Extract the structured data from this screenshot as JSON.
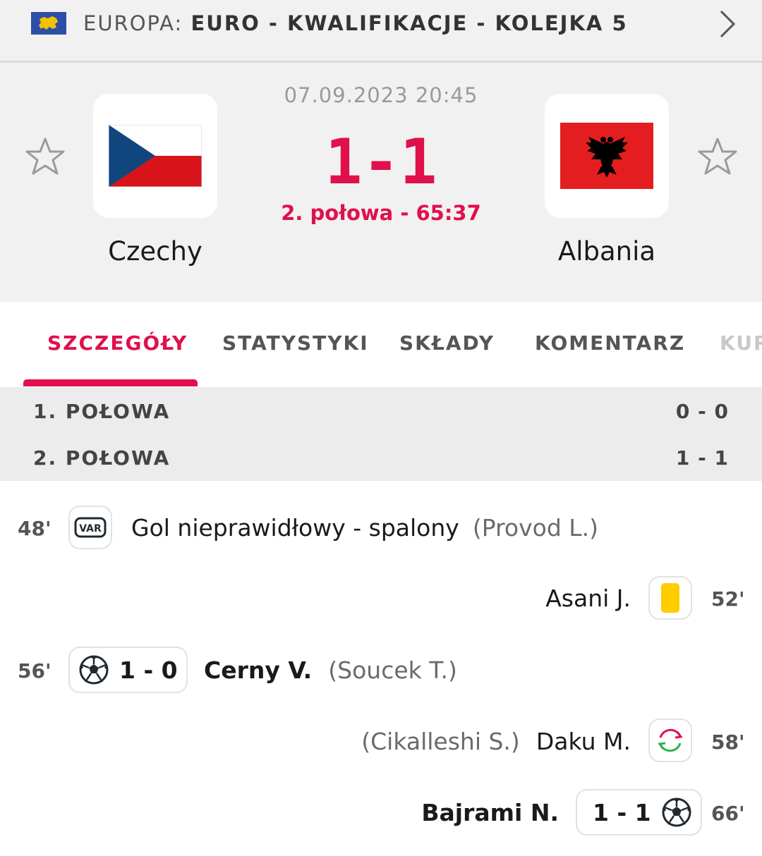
{
  "league": {
    "region": "EUROPA:",
    "competition": "EURO - KWALIFIKACJE - KOLEJKA 5",
    "flag_icon": "europe-flag-icon"
  },
  "match": {
    "datetime": "07.09.2023 20:45",
    "score": "1-1",
    "status": "2. połowa - 65:37",
    "home": {
      "name": "Czechy",
      "flag_icon": "czech-flag-icon"
    },
    "away": {
      "name": "Albania",
      "flag_icon": "albania-flag-icon"
    }
  },
  "tabs": [
    {
      "label": "SZCZEGÓŁY",
      "active": true
    },
    {
      "label": "STATYSTYKI",
      "active": false
    },
    {
      "label": "SKŁADY",
      "active": false
    },
    {
      "label": "KOMENTARZ",
      "active": false
    },
    {
      "label": "KURSY",
      "active": false
    }
  ],
  "periods": [
    {
      "label": "1. POŁOWA",
      "score": "0 - 0"
    },
    {
      "label": "2. POŁOWA",
      "score": "1 - 1"
    }
  ],
  "events": [
    {
      "minute": "48'",
      "side": "home",
      "icon": "var-icon",
      "text": "Gol nieprawidłowy - spalony",
      "assist": "(Provod L.)"
    },
    {
      "minute": "52'",
      "side": "away",
      "icon": "yellow-card-icon",
      "player": "Asani J."
    },
    {
      "minute": "56'",
      "side": "home",
      "icon": "soccer-ball-icon",
      "score": "1 - 0",
      "player": "Cerny V.",
      "assist": "(Soucek T.)"
    },
    {
      "minute": "58'",
      "side": "away",
      "icon": "substitution-icon",
      "player": "Daku M.",
      "assist": "(Cikalleshi S.)"
    },
    {
      "minute": "66'",
      "side": "away",
      "icon": "soccer-ball-icon",
      "score": "1 - 1",
      "player": "Bajrami N."
    }
  ],
  "colors": {
    "accent": "#e0104b",
    "yellow_card": "#ffcc00",
    "header_bg": "#f1f1f1"
  }
}
